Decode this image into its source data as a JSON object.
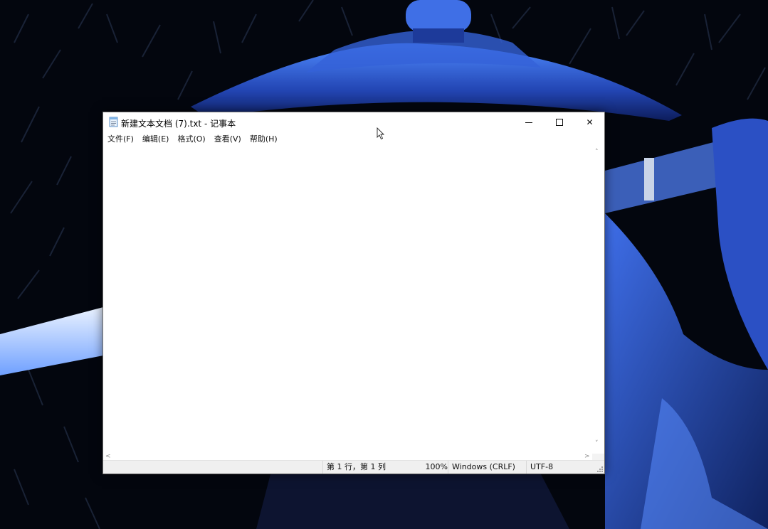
{
  "window": {
    "title": "新建文本文档 (7).txt - 记事本",
    "icon": "notepad-icon"
  },
  "caption_buttons": {
    "minimize_icon": "minimize-icon",
    "maximize_icon": "maximize-icon",
    "close_icon": "close-icon",
    "close_glyph": "✕"
  },
  "menu": {
    "items": [
      {
        "label": "文件(F)"
      },
      {
        "label": "编辑(E)"
      },
      {
        "label": "格式(O)"
      },
      {
        "label": "查看(V)"
      },
      {
        "label": "帮助(H)"
      }
    ]
  },
  "editor": {
    "content": ""
  },
  "scrollbars": {
    "up": "˄",
    "down": "˅",
    "left": "<",
    "right": ">"
  },
  "status": {
    "position": "第 1 行，第 1 列",
    "zoom": "100%",
    "line_ending": "Windows (CRLF)",
    "encoding": "UTF-8"
  },
  "colors": {
    "wallpaper_dark": "#03060e",
    "wallpaper_blue": "#2f5fd6",
    "window_bg": "#ffffff",
    "statusbar_bg": "#f0f0f0"
  }
}
